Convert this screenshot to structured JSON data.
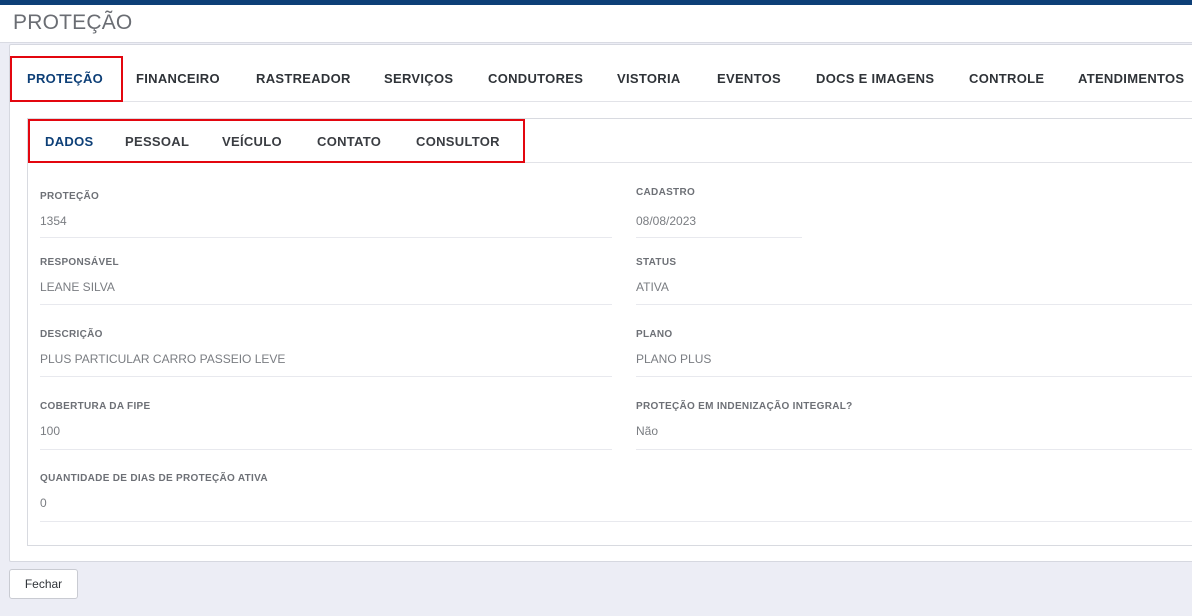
{
  "page": {
    "title": "PROTEÇÃO"
  },
  "main_tabs": [
    {
      "label": "PROTEÇÃO",
      "active": true
    },
    {
      "label": "FINANCEIRO"
    },
    {
      "label": "RASTREADOR"
    },
    {
      "label": "SERVIÇOS"
    },
    {
      "label": "CONDUTORES"
    },
    {
      "label": "VISTORIA"
    },
    {
      "label": "EVENTOS"
    },
    {
      "label": "DOCS E IMAGENS"
    },
    {
      "label": "CONTROLE"
    },
    {
      "label": "ATENDIMENTOS"
    }
  ],
  "sub_tabs": [
    {
      "label": "DADOS",
      "active": true
    },
    {
      "label": "PESSOAL"
    },
    {
      "label": "VEÍCULO"
    },
    {
      "label": "CONTATO"
    },
    {
      "label": "CONSULTOR"
    }
  ],
  "fields": {
    "protecao": {
      "label": "PROTEÇÃO",
      "value": "1354"
    },
    "cadastro": {
      "label": "CADASTRO",
      "value": "08/08/2023"
    },
    "responsavel": {
      "label": "RESPONSÁVEL",
      "value": "LEANE SILVA"
    },
    "status": {
      "label": "STATUS",
      "value": "ATIVA"
    },
    "descricao": {
      "label": "DESCRIÇÃO",
      "value": "PLUS PARTICULAR CARRO PASSEIO LEVE"
    },
    "plano": {
      "label": "PLANO",
      "value": "PLANO PLUS"
    },
    "cobertura_fipe": {
      "label": "COBERTURA DA FIPE",
      "value": "100"
    },
    "indenizacao_integral": {
      "label": "PROTEÇÃO EM INDENIZAÇÃO INTEGRAL?",
      "value": "Não"
    },
    "dias_protecao_ativa": {
      "label": "QUANTIDADE DE DIAS DE PROTEÇÃO ATIVA",
      "value": "0"
    }
  },
  "footer": {
    "close_label": "Fechar"
  },
  "colors": {
    "accent": "#0d3f77",
    "highlight": "#e3060f",
    "background": "#ecedf5"
  }
}
